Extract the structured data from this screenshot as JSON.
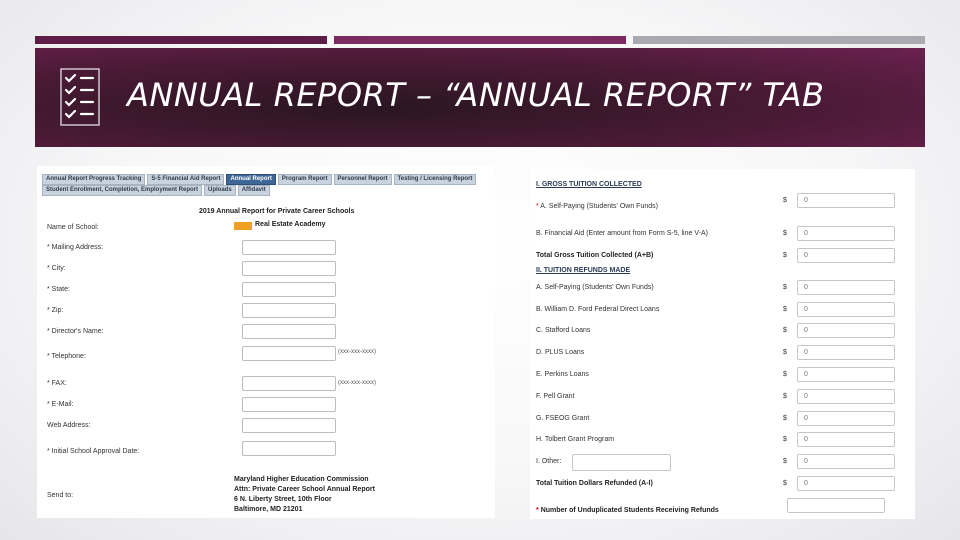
{
  "slide": {
    "title": "ANNUAL REPORT – “ANNUAL REPORT” TAB",
    "accent_colors": [
      "#5c1d47",
      "#7d2a63",
      "#a9aab0"
    ],
    "banner_color": "#4a1a35"
  },
  "left": {
    "tabs_row1": [
      "Annual Report Progress Tracking",
      "S-5 Financial Aid Report",
      "Annual Report",
      "Program Report",
      "Personnel Report",
      "Testing / Licensing Report"
    ],
    "tabs_row2": [
      "Student Enrollment, Completion, Employment Report",
      "Uploads",
      "Affidavit"
    ],
    "active_tab": "Annual Report",
    "form_title": "2019 Annual Report for Private Career Schools",
    "school_label": "Name of School:",
    "school_name": "Real Estate Academy",
    "fields": [
      {
        "label": "* Mailing Address:"
      },
      {
        "label": "* City:"
      },
      {
        "label": "* State:"
      },
      {
        "label": "* Zip:"
      },
      {
        "label": "* Director's Name:"
      },
      {
        "label": "* Telephone:",
        "hint": "(xxx-xxx-xxxx)"
      },
      {
        "label": "* FAX:",
        "hint": "(xxx-xxx-xxxx)"
      },
      {
        "label": "* E-Mail:"
      },
      {
        "label": "Web Address:"
      },
      {
        "label": "* Initial School Approval Date:"
      }
    ],
    "send_label": "Send to:",
    "send_lines": [
      "Maryland Higher Education Commission",
      "Attn: Private Career School Annual Report",
      "6 N. Liberty Street, 10th Floor",
      "Baltimore, MD 21201"
    ]
  },
  "right": {
    "section1": "I. GROSS TUITION COLLECTED",
    "gross": [
      {
        "label": "* A. Self-Paying (Students' Own Funds)",
        "value": "0"
      },
      {
        "label": "B. Financial Aid (Enter amount from Form S-5, line V-A)",
        "value": "0"
      },
      {
        "label": "Total Gross Tuition Collected (A+B)",
        "value": "0"
      }
    ],
    "section2": "II. TUITION REFUNDS MADE",
    "refunds": [
      {
        "label": "A. Self-Paying (Students' Own Funds)",
        "value": "0"
      },
      {
        "label": "B. William D. Ford Federal Direct Loans",
        "value": "0"
      },
      {
        "label": "C. Stafford Loans",
        "value": "0"
      },
      {
        "label": "D. PLUS Loans",
        "value": "0"
      },
      {
        "label": "E. Perkins Loans",
        "value": "0"
      },
      {
        "label": "F. Pell Grant",
        "value": "0"
      },
      {
        "label": "G. FSEOG Grant",
        "value": "0"
      },
      {
        "label": "H. Tolbert Grant Program",
        "value": "0"
      },
      {
        "label": "I. Other:",
        "value": "0"
      },
      {
        "label": "Total Tuition Dollars Refunded (A-I)",
        "value": "0"
      }
    ],
    "currency": "$",
    "unduplicated_label": "* Number of Unduplicated Students Receiving Refunds"
  }
}
